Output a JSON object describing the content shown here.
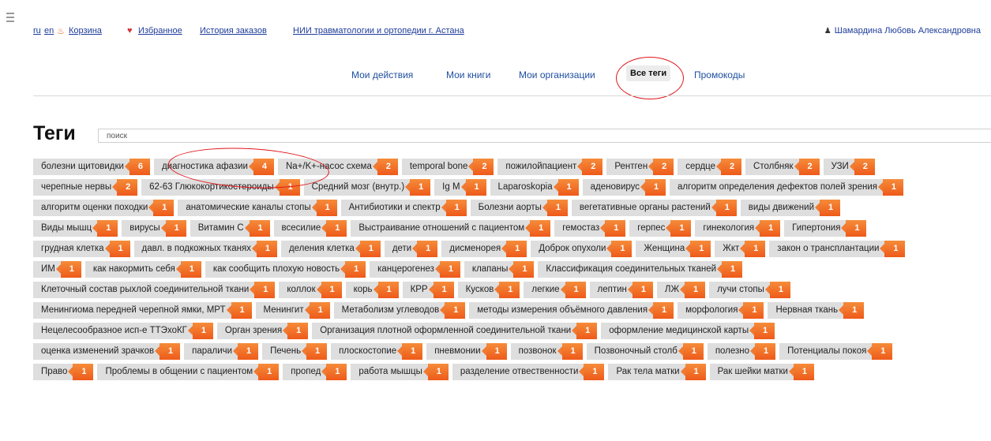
{
  "topbar": {
    "lang_ru": "ru",
    "lang_en": "en",
    "basket": "Корзина",
    "favorites": "Избранное",
    "orders": "История заказов",
    "org": "НИИ травматологии и ортопедии г. Астана",
    "user": "Шамардина Любовь Александровна"
  },
  "tabs": {
    "actions": "Мои действия",
    "books": "Мои книги",
    "orgs": "Мои организации",
    "all_tags": "Все теги",
    "promo": "Промокоды"
  },
  "page": {
    "title": "Теги",
    "search_placeholder": "поиск"
  },
  "colors": {
    "badge": "#f0681f",
    "tag_bg": "#dedede",
    "link": "#1f3c9a",
    "highlight_ring": "#e0141b"
  },
  "tag_rows": [
    [
      {
        "label": "болезни щитовидки",
        "count": "6"
      },
      {
        "label": "диагностика афазии",
        "count": "4"
      },
      {
        "label": "Na+/K+-насос схема",
        "count": "2"
      },
      {
        "label": "temporal bone",
        "count": "2"
      },
      {
        "label": "пожилойпациент",
        "count": "2"
      },
      {
        "label": "Рентген",
        "count": "2"
      },
      {
        "label": "сердце",
        "count": "2"
      },
      {
        "label": "Столбняк",
        "count": "2"
      },
      {
        "label": "УЗИ",
        "count": "2"
      }
    ],
    [
      {
        "label": "черепные нервы",
        "count": "2"
      },
      {
        "label": "62-63 Глюкокортикостероиды",
        "count": "1"
      },
      {
        "label": "Средний мозг (внутр.)",
        "count": "1"
      },
      {
        "label": "Ig M",
        "count": "1"
      },
      {
        "label": "Laparoskopia",
        "count": "1"
      },
      {
        "label": "аденовирус",
        "count": "1"
      },
      {
        "label": "алгоритм определения дефектов полей зрения",
        "count": "1"
      }
    ],
    [
      {
        "label": "алгоритм оценки походки",
        "count": "1"
      },
      {
        "label": "анатомические каналы стопы",
        "count": "1"
      },
      {
        "label": "Антибиотики и спектр",
        "count": "1"
      },
      {
        "label": "Болезни аорты",
        "count": "1"
      },
      {
        "label": "вегетативные органы растений",
        "count": "1"
      },
      {
        "label": "виды движений",
        "count": "1"
      }
    ],
    [
      {
        "label": "Виды мышц",
        "count": "1"
      },
      {
        "label": "вирусы",
        "count": "1"
      },
      {
        "label": "Витамин С",
        "count": "1"
      },
      {
        "label": "всесилие",
        "count": "1"
      },
      {
        "label": "Выстраивание отношений с пациентом",
        "count": "1"
      },
      {
        "label": "гемостаз",
        "count": "1"
      },
      {
        "label": "герпес",
        "count": "1"
      },
      {
        "label": "гинекология",
        "count": "1"
      },
      {
        "label": "Гипертония",
        "count": "1"
      }
    ],
    [
      {
        "label": "грудная клетка",
        "count": "1"
      },
      {
        "label": "давл. в подкожных тканях",
        "count": "1"
      },
      {
        "label": "деления клетка",
        "count": "1"
      },
      {
        "label": "дети",
        "count": "1"
      },
      {
        "label": "дисменорея",
        "count": "1"
      },
      {
        "label": "Доброк опухоли",
        "count": "1"
      },
      {
        "label": "Женщина",
        "count": "1"
      },
      {
        "label": "Жкт",
        "count": "1"
      },
      {
        "label": "закон о трансплантации",
        "count": "1"
      }
    ],
    [
      {
        "label": "ИМ",
        "count": "1"
      },
      {
        "label": "как накормить себя",
        "count": "1"
      },
      {
        "label": "как сообщить плохую новость",
        "count": "1"
      },
      {
        "label": "канцерогенез",
        "count": "1"
      },
      {
        "label": "клапаны",
        "count": "1"
      },
      {
        "label": "Классификация соединительных тканей",
        "count": "1"
      }
    ],
    [
      {
        "label": "Клеточный состав рыхлой соединительной ткани",
        "count": "1"
      },
      {
        "label": "коллок",
        "count": "1"
      },
      {
        "label": "корь",
        "count": "1"
      },
      {
        "label": "КРР",
        "count": "1"
      },
      {
        "label": "Кусков",
        "count": "1"
      },
      {
        "label": "легкие",
        "count": "1"
      },
      {
        "label": "лептин",
        "count": "1"
      },
      {
        "label": "ЛЖ",
        "count": "1"
      },
      {
        "label": "лучи стопы",
        "count": "1"
      }
    ],
    [
      {
        "label": "Менингиома передней черепной ямки, МРТ",
        "count": "1"
      },
      {
        "label": "Менингит",
        "count": "1"
      },
      {
        "label": "Метаболизм углеводов",
        "count": "1"
      },
      {
        "label": "методы измерения объёмного давления",
        "count": "1"
      },
      {
        "label": "морфология",
        "count": "1"
      },
      {
        "label": "Нервная ткань",
        "count": "1"
      }
    ],
    [
      {
        "label": "Нецелесообразное исп-е ТТЭхоКГ",
        "count": "1"
      },
      {
        "label": "Орган зрения",
        "count": "1"
      },
      {
        "label": "Организация плотной оформленной соединительной ткани",
        "count": "1"
      },
      {
        "label": "оформление медицинской карты",
        "count": "1"
      }
    ],
    [
      {
        "label": "оценка изменений зрачков",
        "count": "1"
      },
      {
        "label": "параличи",
        "count": "1"
      },
      {
        "label": "Печень",
        "count": "1"
      },
      {
        "label": "плоскостопие",
        "count": "1"
      },
      {
        "label": "пневмонии",
        "count": "1"
      },
      {
        "label": "позвонок",
        "count": "1"
      },
      {
        "label": "Позвоночный столб",
        "count": "1"
      },
      {
        "label": "полезно",
        "count": "1"
      },
      {
        "label": "Потенциалы покоя",
        "count": "1"
      }
    ],
    [
      {
        "label": "Право",
        "count": "1"
      },
      {
        "label": "Проблемы в общении с пациентом",
        "count": "1"
      },
      {
        "label": "пропед",
        "count": "1"
      },
      {
        "label": "работа мышцы",
        "count": "1"
      },
      {
        "label": "разделение отвественности",
        "count": "1"
      },
      {
        "label": "Рак тела матки",
        "count": "1"
      },
      {
        "label": "Рак шейки матки",
        "count": "1"
      }
    ]
  ]
}
